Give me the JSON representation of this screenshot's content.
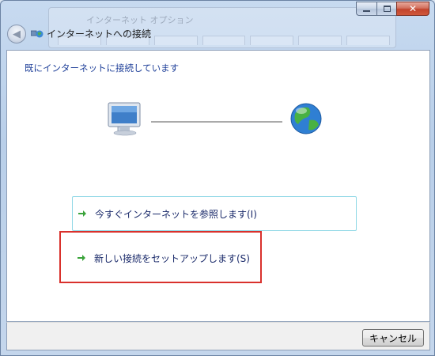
{
  "window": {
    "background_title": "インターネット オプション",
    "title": "インターネットへの接続",
    "close_glyph": "✕",
    "back_glyph": "◀"
  },
  "content": {
    "heading": "既にインターネットに接続しています"
  },
  "options": [
    {
      "label": "今すぐインターネットを参照します(I)"
    },
    {
      "label": "新しい接続をセットアップします(S)"
    }
  ],
  "buttons": {
    "cancel": "キャンセル"
  },
  "colors": {
    "heading": "#1e3f99",
    "option_text": "#1a2a6a",
    "arrow": "#3aa33a",
    "highlight": "#d9312c",
    "hover_border": "#8fd8e6"
  }
}
